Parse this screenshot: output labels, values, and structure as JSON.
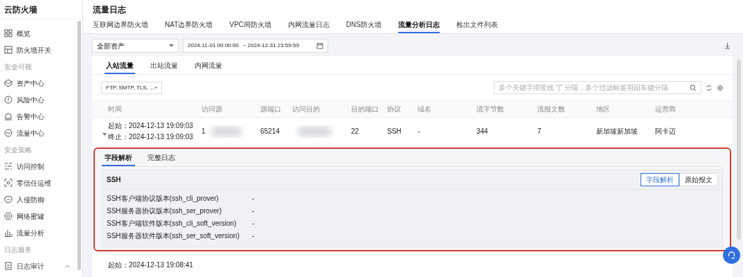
{
  "sidebar": {
    "title": "云防火墙",
    "sections": [
      {
        "items": [
          {
            "label": "概览"
          },
          {
            "label": "防火墙开关"
          }
        ]
      },
      {
        "heading": "安全可视",
        "items": [
          {
            "label": "资产中心"
          },
          {
            "label": "风险中心"
          },
          {
            "label": "告警中心"
          },
          {
            "label": "流量中心"
          }
        ]
      },
      {
        "heading": "安全策略",
        "items": [
          {
            "label": "访问控制"
          },
          {
            "label": "零信任运维"
          },
          {
            "label": "入侵防御"
          },
          {
            "label": "网络蜜罐"
          },
          {
            "label": "流量分析"
          }
        ]
      },
      {
        "heading": "日志服务",
        "items": [
          {
            "label": "日志审计",
            "expanded": true
          }
        ]
      }
    ]
  },
  "page_title": "流量日志",
  "tabs": [
    {
      "label": "互联网边界防火墙",
      "selected": false
    },
    {
      "label": "NAT边界防火墙",
      "selected": false
    },
    {
      "label": "VPC间防火墙",
      "selected": false
    },
    {
      "label": "内网流量日志",
      "selected": false
    },
    {
      "label": "DNS防火墙",
      "selected": false
    },
    {
      "label": "流量分析日志",
      "selected": true
    },
    {
      "label": "检出文件列表",
      "selected": false
    }
  ],
  "asset_select": "全部资产",
  "date_range": {
    "start": "2024-11-01 00:00:00",
    "end": "~ 2024-12-31 23:59:59"
  },
  "sub_tabs": [
    {
      "label": "入站流量",
      "selected": true
    },
    {
      "label": "出站流量",
      "selected": false
    },
    {
      "label": "内网流量",
      "selected": false
    }
  ],
  "protocol_select": "FTP, SMTP, TLS, ...",
  "search": {
    "placeholder": "多个关键字用竖线 “|” 分隔，多个过滤标签用回车键分隔"
  },
  "table": {
    "columns": [
      "时间",
      "访问源",
      "源端口",
      "访问目的",
      "目的端口",
      "协议",
      "域名",
      "流字节数",
      "流报文数",
      "地区",
      "运营商"
    ],
    "rows": [
      {
        "start": "起始：2024-12-13 19:09:03",
        "end": "终止：2024-12-13 19:09:03",
        "source": "1",
        "source_port": "65214",
        "dest_port": "22",
        "protocol": "SSH",
        "domain": "-",
        "bytes": "344",
        "packets": "7",
        "region": "新加坡新加坡",
        "isp": "阿卡迈",
        "expanded": true
      }
    ],
    "next_row_start": "起始：2024-12-13 19:08:41"
  },
  "detail": {
    "tabs": [
      {
        "label": "字段解析",
        "selected": true
      },
      {
        "label": "完整日志",
        "selected": false
      }
    ],
    "protocol": "SSH",
    "view_buttons": [
      {
        "label": "字段解析",
        "selected": true
      },
      {
        "label": "原始报文",
        "selected": false
      }
    ],
    "fields": [
      {
        "name": "SSH客户端协议版本(ssh_cli_prover)",
        "value": "-"
      },
      {
        "name": "SSH服务器协议版本(ssh_ser_prover)",
        "value": "-"
      },
      {
        "name": "SSH客户端软件版本(ssh_cli_soft_version)",
        "value": "-"
      },
      {
        "name": "SSH服务器软件版本(ssh_ser_soft_version)",
        "value": "-"
      }
    ]
  }
}
